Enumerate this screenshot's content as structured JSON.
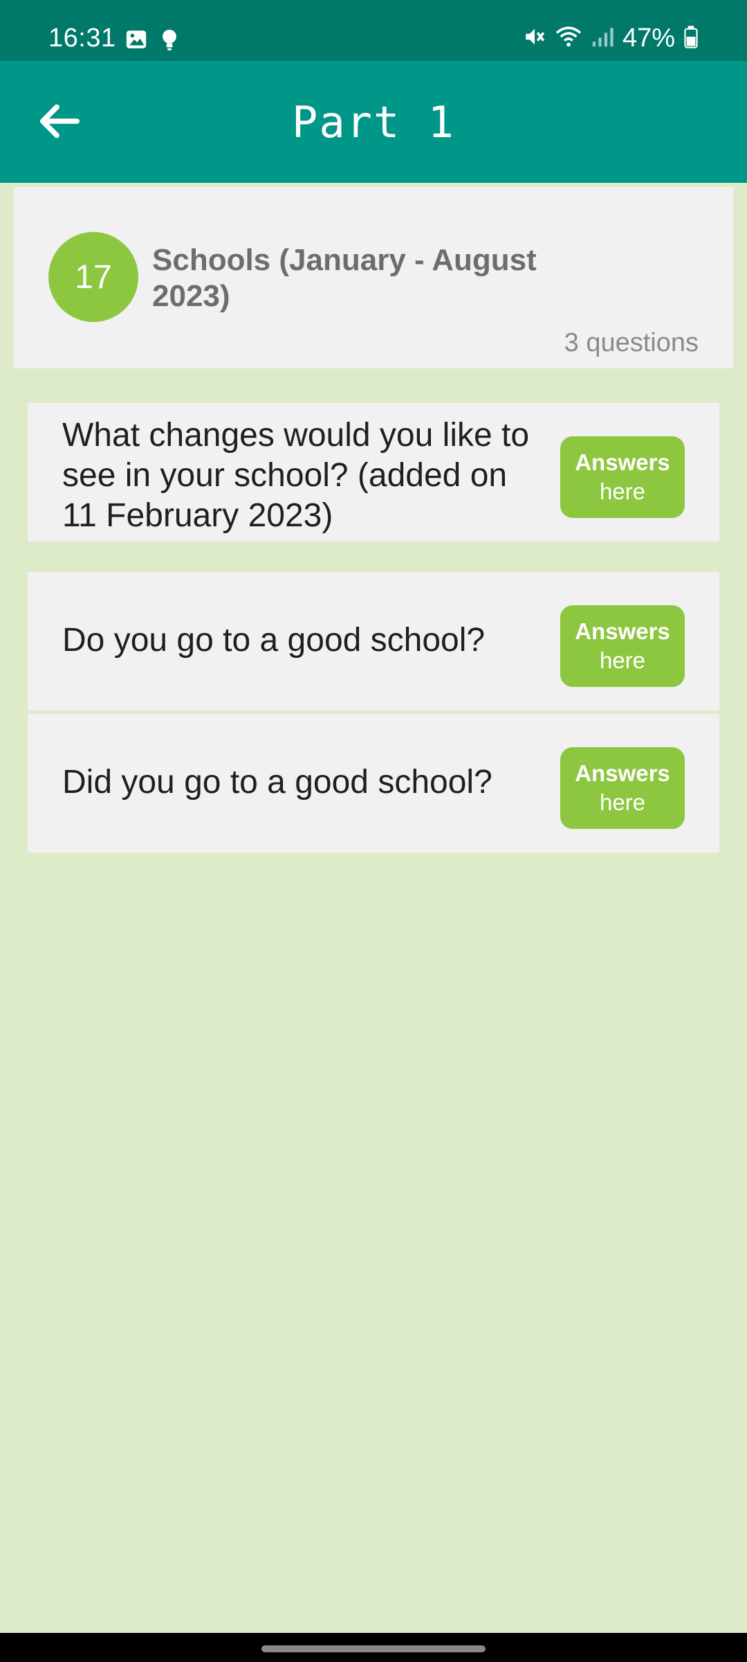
{
  "status_bar": {
    "time": "16:31",
    "battery": "47%",
    "icons": [
      "image-icon",
      "bulb-icon",
      "mute-icon",
      "wifi-icon",
      "signal-icon",
      "battery-icon"
    ]
  },
  "app_bar": {
    "title": "Part 1",
    "back_icon": "arrow-left-icon"
  },
  "topic": {
    "number": "17",
    "title": "Schools (January - August 2023)",
    "count": "3 questions"
  },
  "questions": [
    {
      "text": "What changes would you like to see in your school? (added on 11 February 2023)",
      "button_title": "Answers",
      "button_sub": "here"
    },
    {
      "text": "Do you go to a good school?",
      "button_title": "Answers",
      "button_sub": "here"
    },
    {
      "text": "Did you go to a good school?",
      "button_title": "Answers",
      "button_sub": "here"
    }
  ],
  "colors": {
    "status_bar": "#00796b",
    "app_bar": "#009688",
    "accent_green": "#8dc63f",
    "background": "#deebc8",
    "card": "#f1f1f1"
  }
}
